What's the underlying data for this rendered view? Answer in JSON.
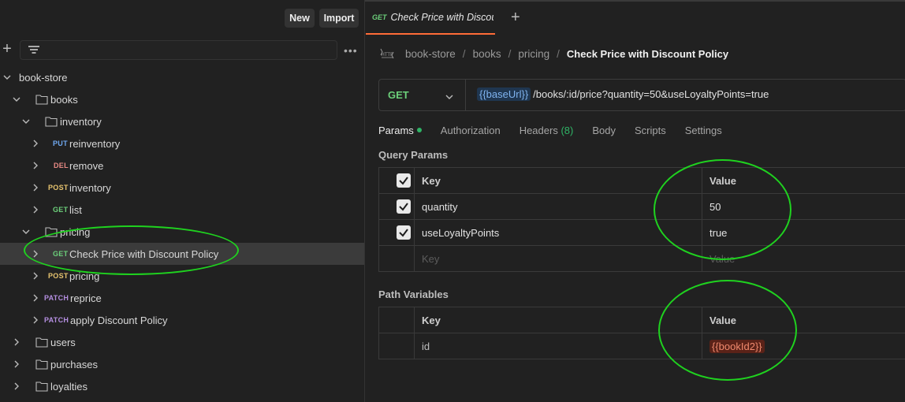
{
  "sidebar": {
    "new_label": "New",
    "import_label": "Import",
    "tree": [
      {
        "label": "book-store",
        "kind": "folder-root",
        "method": ""
      },
      {
        "label": "books",
        "kind": "folder",
        "method": ""
      },
      {
        "label": "inventory",
        "kind": "folder",
        "method": ""
      },
      {
        "label": "reinventory",
        "kind": "request",
        "method": "PUT"
      },
      {
        "label": "remove",
        "kind": "request",
        "method": "DEL"
      },
      {
        "label": "inventory",
        "kind": "request",
        "method": "POST"
      },
      {
        "label": "list",
        "kind": "request",
        "method": "GET"
      },
      {
        "label": "pricing",
        "kind": "folder",
        "method": ""
      },
      {
        "label": "Check Price with Discount Policy",
        "kind": "request",
        "method": "GET"
      },
      {
        "label": "pricing",
        "kind": "request",
        "method": "POST"
      },
      {
        "label": "reprice",
        "kind": "request",
        "method": "PATCH"
      },
      {
        "label": "apply Discount Policy",
        "kind": "request",
        "method": "PATCH"
      },
      {
        "label": "users",
        "kind": "folder",
        "method": ""
      },
      {
        "label": "purchases",
        "kind": "folder",
        "method": ""
      },
      {
        "label": "loyalties",
        "kind": "folder",
        "method": ""
      }
    ]
  },
  "tab": {
    "method": "GET",
    "title": "Check Price with Discou"
  },
  "breadcrumb": {
    "items": [
      "book-store",
      "books",
      "pricing"
    ],
    "current": "Check Price with Discount Policy",
    "separator": "/"
  },
  "request": {
    "method": "GET",
    "url_var": "{{baseUrl}}",
    "url_path": "/books/:id/price?quantity=50&useLoyaltyPoints=true"
  },
  "request_tabs": {
    "params": "Params",
    "authorization": "Authorization",
    "headers": "Headers",
    "headers_count": "(8)",
    "body": "Body",
    "scripts": "Scripts",
    "settings": "Settings"
  },
  "query_params": {
    "title": "Query Params",
    "key_header": "Key",
    "value_header": "Value",
    "rows": [
      {
        "key": "quantity",
        "value": "50",
        "checked": true
      },
      {
        "key": "useLoyaltyPoints",
        "value": "true",
        "checked": true
      }
    ],
    "key_placeholder": "Key",
    "value_placeholder": "Value"
  },
  "path_variables": {
    "title": "Path Variables",
    "key_header": "Key",
    "value_header": "Value",
    "rows": [
      {
        "key": "id",
        "value": "{{bookId2}}"
      }
    ]
  },
  "colors": {
    "accent": "#ff6c37",
    "get": "#6ccf7a",
    "put": "#6fa8ef",
    "del": "#e88a84",
    "post": "#e7c46f",
    "patch": "#b48ee0",
    "annotation": "#1fd21f"
  }
}
